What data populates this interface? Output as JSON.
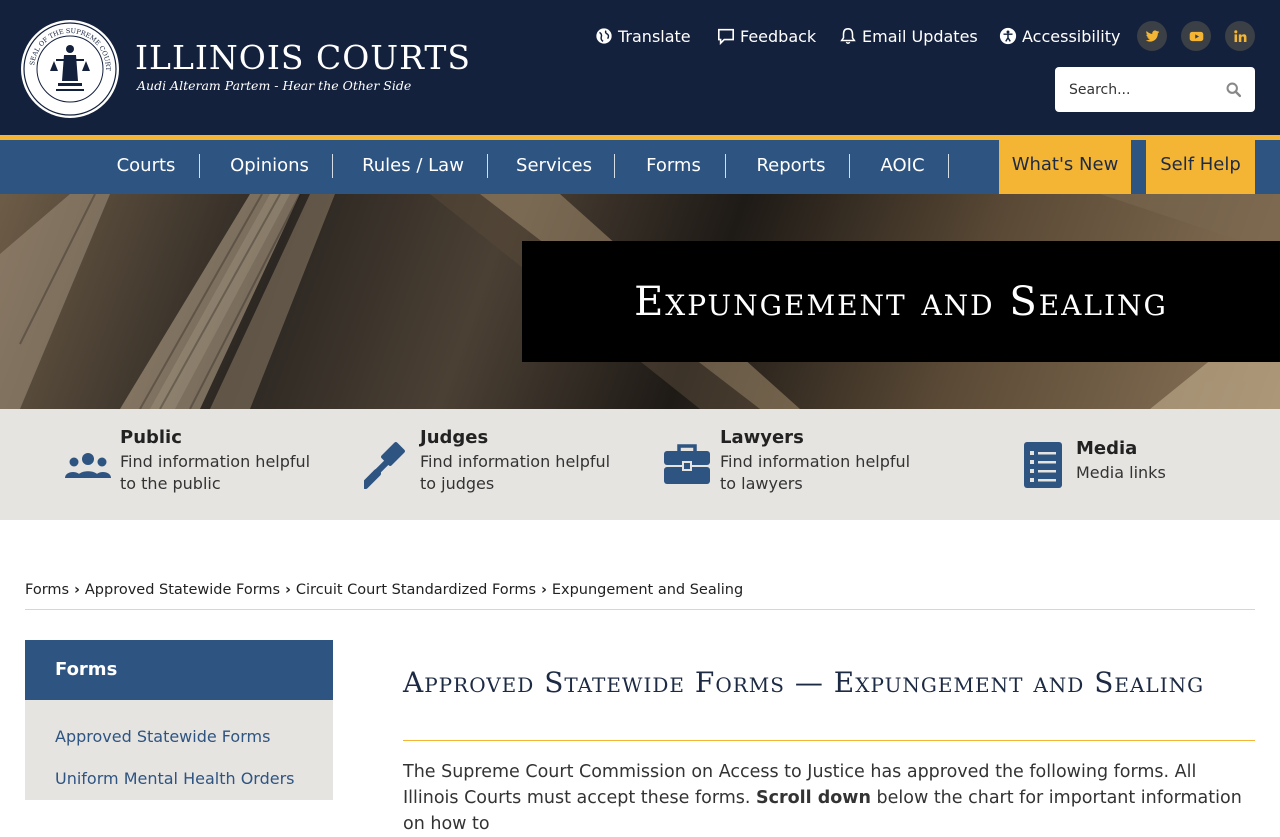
{
  "brand": {
    "title": "ILLINOIS COURTS",
    "subtitle": "Audi Alteram Partem - Hear the Other Side"
  },
  "utility_nav": [
    {
      "label": "Translate",
      "icon": "globe-icon"
    },
    {
      "label": "Feedback",
      "icon": "comment-icon"
    },
    {
      "label": "Email Updates",
      "icon": "bell-icon"
    },
    {
      "label": "Accessibility",
      "icon": "accessibility-icon"
    }
  ],
  "social": [
    "twitter-icon",
    "youtube-icon",
    "linkedin-icon"
  ],
  "search": {
    "placeholder": "Search..."
  },
  "main_nav": [
    "Courts",
    "Opinions",
    "Rules / Law",
    "Services",
    "Forms",
    "Reports",
    "AOIC"
  ],
  "nav_cta": [
    "What's New",
    "Self Help"
  ],
  "hero": {
    "title": "Expungement and Sealing"
  },
  "audience": [
    {
      "title": "Public",
      "desc": "Find information helpful to the public",
      "icon": "users-icon"
    },
    {
      "title": "Judges",
      "desc": "Find information helpful to judges",
      "icon": "gavel-icon"
    },
    {
      "title": "Lawyers",
      "desc": "Find information helpful to lawyers",
      "icon": "briefcase-icon"
    },
    {
      "title": "Media",
      "desc": "Media links",
      "icon": "list-icon"
    }
  ],
  "breadcrumb": [
    "Forms",
    "Approved Statewide Forms",
    "Circuit Court Standardized Forms",
    "Expungement and Sealing"
  ],
  "sidebar": {
    "heading": "Forms",
    "links": [
      "Approved Statewide Forms",
      "Uniform Mental Health Orders"
    ]
  },
  "main": {
    "title": "Approved Statewide Forms — Expungement and Sealing",
    "intro": "The Supreme Court Commission on Access to Justice has approved the following forms. All Illinois Courts must accept these forms.",
    "intro_bold": "Scroll down",
    "intro_rest": "below the chart for important information on how to"
  },
  "colors": {
    "header_bg": "#14213d",
    "nav_bg": "#2e5481",
    "accent_gold": "#f4b535",
    "strip_bg": "#e6e4e1"
  }
}
